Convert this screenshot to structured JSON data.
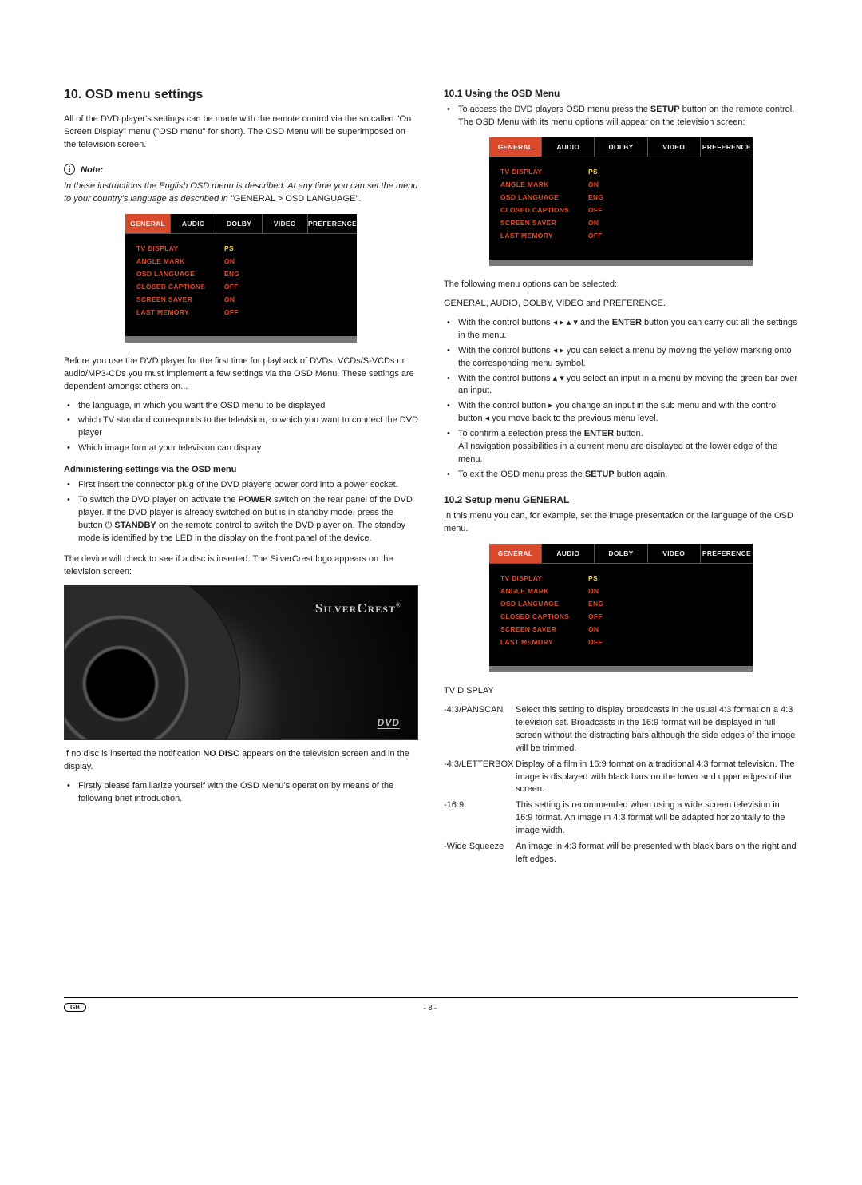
{
  "leftCol": {
    "sectionTitle": "10. OSD menu settings",
    "intro": "All of the DVD player's settings can be made with the remote control via the so called \"On Screen Display\" menu (\"OSD menu\" for short). The OSD Menu will be superimposed on the television screen.",
    "noteLabel": "Note:",
    "noteBody": "In these instructions the English OSD menu is described. At any time you can set the menu to your country's language as described in \"",
    "noteBodyTail": "GENERAL > OSD LANGUAGE\".",
    "preOsdAfter": "Before you use the DVD player for the first time for playback of DVDs, VCDs/S-VCDs or audio/MP3-CDs you must implement a few settings via the OSD Menu. These settings are dependent amongst others on...",
    "dependsList": [
      "the language, in which you want the OSD menu to be displayed",
      "which TV standard corresponds to the television, to which you want to connect the DVD player",
      "Which image format your television can display"
    ],
    "adminHeading": "Administering settings via the OSD menu",
    "adminList1": "First insert the connector plug of the DVD player's power cord into a power socket.",
    "adminList2a": "To switch the DVD player on activate the ",
    "adminList2_power": "POWER",
    "adminList2b": " switch on the rear panel of the DVD player. If the DVD player is already switched on but is in standby mode, press the button ",
    "adminList2_standby": "STANDBY",
    "adminList2c": " on the remote control to switch the DVD player on. The standby mode is identified by the LED in the display on the front panel of the device.",
    "afterAdmin": "The device will check to see if a disc is inserted. The SilverCrest logo appears on the television screen:",
    "splashLogo": "SILVERCREST",
    "splashDvd": "DVD",
    "noDiscPara": "If no disc is inserted the notification ",
    "noDiscBold": "NO DISC",
    "noDiscTail": " appears on the television screen and in the display.",
    "familiarize": "Firstly please familiarize yourself with the OSD Menu's operation by means of the following brief introduction."
  },
  "rightCol": {
    "h101": "10.1 Using the OSD Menu",
    "access1": "To access the DVD players OSD menu press the ",
    "setup": "SETUP",
    "access2": " button on the remote control. The OSD Menu with its menu options will appear on the television screen:",
    "followLine": "The following menu options can be selected:",
    "menuNames": "GENERAL, AUDIO, DOLBY, VIDEO and PREFERENCE.",
    "ctrl1a": "With the control buttons ",
    "ctrl1b": " and the ",
    "enter": "ENTER",
    "ctrl1c": " button you can carry out all the settings in the menu.",
    "ctrl2a": "With the control buttons ",
    "ctrl2b": " you can select a menu by moving the yellow marking onto the corresponding menu symbol.",
    "ctrl3a": "With the control buttons ",
    "ctrl3b": " you select an input in a menu by moving the green bar over an input.",
    "ctrl4a": "With the control button ",
    "ctrl4b": " you change an input in the sub menu and with the control button ",
    "ctrl4c": " you move back to the previous menu level.",
    "ctrl5a": "To confirm a selection press the ",
    "ctrl5b": " button.",
    "ctrl5note": "All navigation possibilities in a current menu are displayed at the lower edge of the menu.",
    "ctrl6a": "To exit the OSD menu press the ",
    "ctrl6b": " button again.",
    "h102": "10.2 Setup menu GENERAL",
    "h102intro": "In this menu you can, for example, set the image presentation or the language of the OSD menu.",
    "tvDisplayHead": "TV DISPLAY",
    "tv": [
      {
        "k": "-4:3/PANSCAN",
        "d": "Select this setting to display broadcasts in the usual 4:3 format on a 4:3 television set. Broadcasts in the 16:9 format will be displayed in full screen without the distracting bars although the side edges of the image will be trimmed."
      },
      {
        "k": "-4:3/LETTERBOX",
        "d": "Display of a film in 16:9 format on a traditional 4:3 format television. The image is displayed with black bars on the lower and upper edges of the screen."
      },
      {
        "k": "-16:9",
        "d": "This setting is recommended when using a wide screen television in 16:9 format. An image in 4:3 format will be adapted horizontally to the image width."
      },
      {
        "k": "-Wide Squeeze",
        "d": "An image in 4:3 format will be presented with black bars on the right and left edges."
      }
    ]
  },
  "osd": {
    "tabs": [
      "GENERAL",
      "AUDIO",
      "DOLBY",
      "VIDEO",
      "PREFERENCE"
    ],
    "rows": [
      {
        "label": "TV DISPLAY",
        "val": "PS"
      },
      {
        "label": "ANGLE MARK",
        "val": "ON"
      },
      {
        "label": "OSD LANGUAGE",
        "val": "ENG"
      },
      {
        "label": "CLOSED CAPTIONS",
        "val": "OFF"
      },
      {
        "label": "SCREEN SAVER",
        "val": "ON"
      },
      {
        "label": "LAST MEMORY",
        "val": "OFF"
      }
    ]
  },
  "footer": {
    "page": "- 8 -",
    "region": "GB"
  }
}
